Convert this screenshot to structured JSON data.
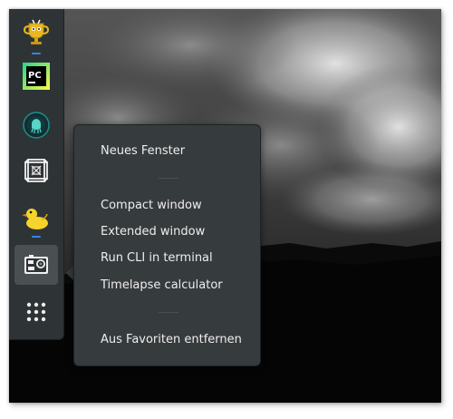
{
  "dock": {
    "items": [
      {
        "name": "trophy-app",
        "icon": "trophy-cup-icon",
        "running": true
      },
      {
        "name": "pycharm",
        "icon": "pycharm-icon",
        "label": "PC",
        "running": false
      },
      {
        "name": "gitkraken",
        "icon": "gitkraken-icon",
        "running": false
      },
      {
        "name": "3d-frame-app",
        "icon": "cube-frame-icon",
        "running": false
      },
      {
        "name": "cyberduck",
        "icon": "duck-icon",
        "running": true
      },
      {
        "name": "gopro-app",
        "icon": "camera-icon",
        "running": false,
        "active": true
      },
      {
        "name": "show-applications",
        "icon": "app-grid-icon",
        "running": false
      }
    ]
  },
  "context_menu": {
    "items": [
      "Neues Fenster",
      "Compact window",
      "Extended window",
      "Run CLI in terminal",
      "Timelapse calculator",
      "Aus Favoriten entfernen"
    ]
  },
  "colors": {
    "dock_bg": "#2e3436",
    "menu_bg": "#363b3d",
    "running_indicator": "#3584e4",
    "menu_text": "#eeeeec"
  }
}
